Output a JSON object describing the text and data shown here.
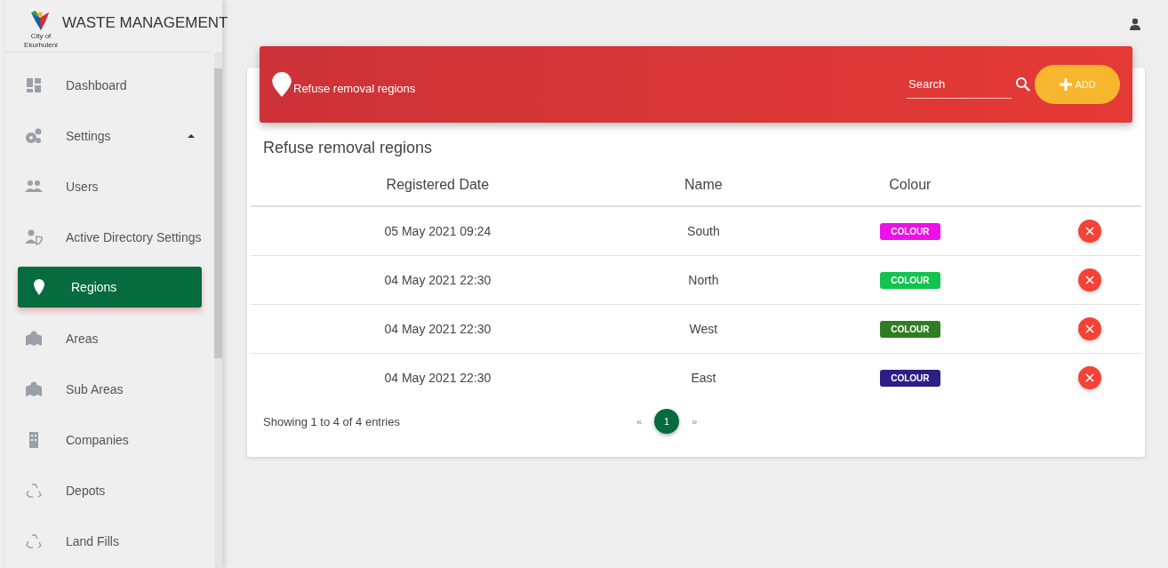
{
  "brand": {
    "title": "WASTE MANAGEMENT",
    "logo_caption": "City of Ekurhuleni"
  },
  "sidebar": {
    "items": [
      {
        "label": "Dashboard",
        "kind": "dashboard",
        "selected": false
      },
      {
        "label": "Settings",
        "kind": "gears",
        "selected": false,
        "expanded": true
      },
      {
        "label": "Users",
        "kind": "users",
        "selected": false
      },
      {
        "label": "Active Directory Settings",
        "kind": "shield",
        "selected": false
      },
      {
        "label": "Regions",
        "kind": "pin",
        "selected": true
      },
      {
        "label": "Areas",
        "kind": "map",
        "selected": false
      },
      {
        "label": "Sub Areas",
        "kind": "map",
        "selected": false
      },
      {
        "label": "Companies",
        "kind": "building",
        "selected": false
      },
      {
        "label": "Depots",
        "kind": "recycle",
        "selected": false
      },
      {
        "label": "Land Fills",
        "kind": "recycle",
        "selected": false
      }
    ]
  },
  "header": {
    "title": "Refuse removal regions",
    "search": {
      "placeholder": "Search"
    },
    "add_button": "ADD"
  },
  "table": {
    "title": "Refuse removal regions",
    "columns": [
      "Registered Date",
      "Name",
      "Colour"
    ],
    "rows": [
      {
        "date": "05 May 2021 09:24",
        "name": "South",
        "colour_label": "COLOUR",
        "color": "#ee10e6"
      },
      {
        "date": "04 May 2021 22:30",
        "name": "North",
        "colour_label": "COLOUR",
        "color": "#12c350"
      },
      {
        "date": "04 May 2021 22:30",
        "name": "West",
        "colour_label": "COLOUR",
        "color": "#2f7d22"
      },
      {
        "date": "04 May 2021 22:30",
        "name": "East",
        "colour_label": "COLOUR",
        "color": "#2b1e85"
      }
    ]
  },
  "footer": {
    "summary": "Showing 1 to 4 of 4 entries",
    "prev": "«",
    "pages": [
      {
        "label": "1",
        "selected": true
      }
    ],
    "next": "»"
  }
}
